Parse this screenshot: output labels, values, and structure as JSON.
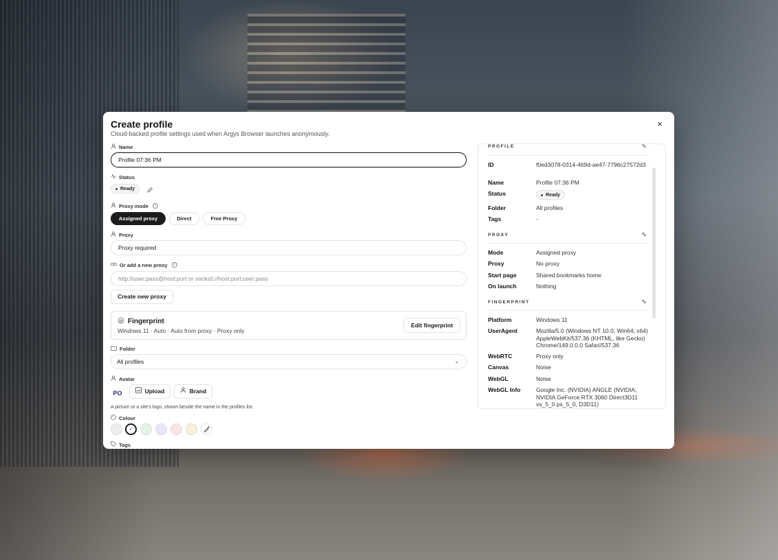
{
  "dialog": {
    "title": "Create profile",
    "subtitle": "Cloud-backed profile settings used when Argys Browser launches anonymously.",
    "close_icon": "×"
  },
  "form": {
    "name": {
      "label": "Name",
      "value": "Profile 07:36 PM"
    },
    "status": {
      "label": "Status",
      "value": "Ready"
    },
    "proxy_mode": {
      "label": "Proxy mode",
      "options": [
        "Assigned proxy",
        "Direct",
        "Free Proxy"
      ],
      "selected": "Assigned proxy"
    },
    "proxy": {
      "label": "Proxy",
      "value": "Proxy required"
    },
    "new_proxy": {
      "label": "Or add a new proxy",
      "placeholder": "http://user:pass@host:port or socks5://host:port:user:pass",
      "button": "Create new proxy"
    },
    "fingerprint": {
      "title": "Fingerprint",
      "summary": "Windows 11 · Auto · Auto from proxy · Proxy only",
      "button": "Edit fingerprint"
    },
    "folder": {
      "label": "Folder",
      "value": "All profiles"
    },
    "avatar": {
      "label": "Avatar",
      "initials": "PO",
      "upload_button": "Upload",
      "brand_button": "Brand",
      "hint": "A picture or a site's logo, shown beside the name in the profiles list."
    },
    "colour": {
      "label": "Colour",
      "swatches": [
        "#eeeeee",
        "#ffffff",
        "#e3f5e6",
        "#e8e6fb",
        "#fbe4e6",
        "#fbf0d9"
      ],
      "selected_mark": "✓"
    },
    "tags": {
      "label": "Tags"
    }
  },
  "summary": {
    "profile": {
      "heading": "PROFILE",
      "id_label": "ID",
      "id_value": "f0ed3078-0314-469d-ae47-7796c27572d3",
      "name_label": "Name",
      "name_value": "Profile 07:36 PM",
      "status_label": "Status",
      "status_value": "Ready",
      "folder_label": "Folder",
      "folder_value": "All profiles",
      "tags_label": "Tags",
      "tags_value": "-"
    },
    "proxy": {
      "heading": "PROXY",
      "mode_label": "Mode",
      "mode_value": "Assigned proxy",
      "proxy_label": "Proxy",
      "proxy_value": "No proxy",
      "start_label": "Start page",
      "start_value": "Shared bookmarks home",
      "launch_label": "On launch",
      "launch_value": "Nothing"
    },
    "fingerprint": {
      "heading": "FINGERPRINT",
      "platform_label": "Platform",
      "platform_value": "Windows 11",
      "ua_label": "UserAgent",
      "ua_value": "Mozilla/5.0 (Windows NT 10.0; Win64; x64) AppleWebKit/537.36 (KHTML, like Gecko) Chrome/149.0.0.0 Safari/537.36",
      "webrtc_label": "WebRTC",
      "webrtc_value": "Proxy only",
      "canvas_label": "Canvas",
      "canvas_value": "Noise",
      "webgl_label": "WebGL",
      "webgl_value": "Noise",
      "webglinfo_label": "WebGL Info",
      "webglinfo_value": "Google Inc. (NVIDIA) ANGLE (NVIDIA, NVIDIA GeForce RTX 3060 Direct3D11 vs_5_0 ps_5_0, D3D11)"
    }
  },
  "icons": {
    "user": "user-icon",
    "status": "activity-icon",
    "proxy": "network-icon",
    "link": "link-icon",
    "fingerprint": "fingerprint-icon",
    "folder": "folder-icon",
    "avatar": "user-circle-icon",
    "colour": "palette-icon",
    "tag": "tag-icon",
    "edit": "pencil-icon",
    "upload": "upload-icon",
    "brand": "brand-icon",
    "eyedropper": "eyedropper-icon",
    "chevron": "chevron-down-icon"
  }
}
